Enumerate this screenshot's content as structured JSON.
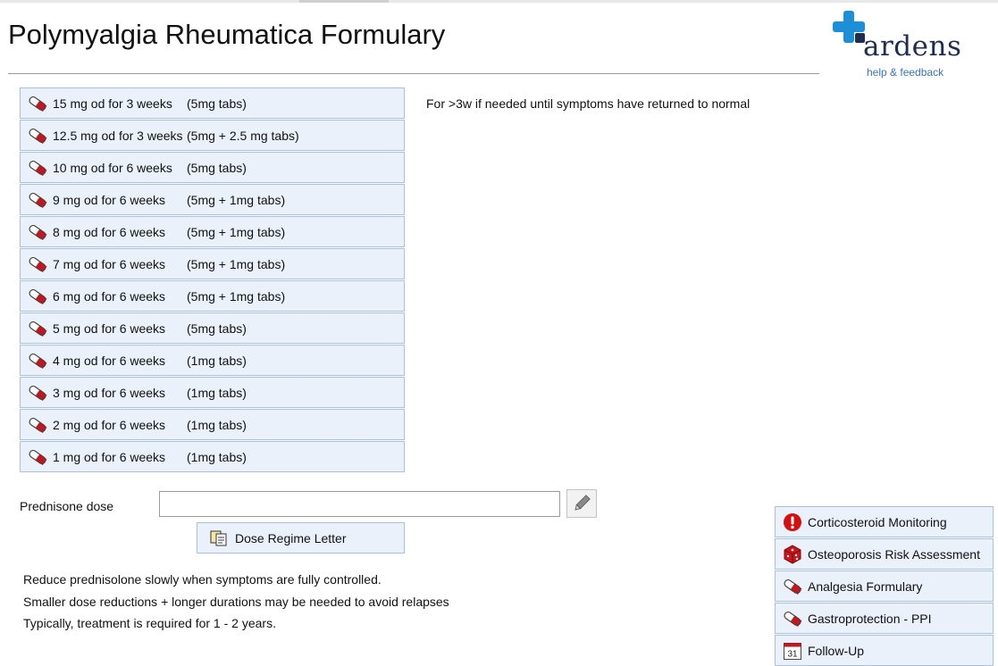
{
  "title": "Polymyalgia Rheumatica Formulary",
  "logo": {
    "name": "ardens",
    "help": "help & feedback"
  },
  "doses": [
    {
      "dose": "15 mg od for 3 weeks",
      "tabs": "(5mg tabs)"
    },
    {
      "dose": "12.5 mg od for 3 weeks",
      "tabs": "(5mg + 2.5 mg tabs)"
    },
    {
      "dose": "10 mg od for 6 weeks",
      "tabs": "(5mg tabs)"
    },
    {
      "dose": "9 mg od for 6 weeks",
      "tabs": "(5mg + 1mg tabs)"
    },
    {
      "dose": "8 mg od for 6 weeks",
      "tabs": "(5mg + 1mg tabs)"
    },
    {
      "dose": "7 mg od for 6 weeks",
      "tabs": "(5mg + 1mg tabs)"
    },
    {
      "dose": "6 mg od for 6 weeks",
      "tabs": "(5mg + 1mg tabs)"
    },
    {
      "dose": "5 mg od for 6 weeks",
      "tabs": "(5mg tabs)"
    },
    {
      "dose": "4 mg od for 6 weeks",
      "tabs": "(1mg tabs)"
    },
    {
      "dose": "3 mg od for 6 weeks",
      "tabs": "(1mg tabs)"
    },
    {
      "dose": "2 mg od for 6 weeks",
      "tabs": "(1mg tabs)"
    },
    {
      "dose": "1 mg od for 6 weeks",
      "tabs": "(1mg tabs)"
    }
  ],
  "first_dose_note": "For >3w if needed until symptoms have returned to normal",
  "prednisone": {
    "label": "Prednisone dose",
    "value": ""
  },
  "letter_button": "Dose Regime Letter",
  "notes": [
    "Reduce prednisolone slowly when symptoms are fully controlled.",
    "Smaller dose reductions + longer durations may be needed to avoid relapses",
    "Typically, treatment is required for 1 - 2 years."
  ],
  "side_links": [
    {
      "label": "Corticosteroid Monitoring",
      "icon": "alert-icon"
    },
    {
      "label": "Osteoporosis Risk Assessment",
      "icon": "dice-icon"
    },
    {
      "label": "Analgesia Formulary",
      "icon": "pill-icon"
    },
    {
      "label": "Gastroprotection - PPI",
      "icon": "pill-icon"
    },
    {
      "label": "Follow-Up",
      "icon": "calendar-icon",
      "calendar_day": "31"
    }
  ],
  "colors": {
    "button_bg": "#eaf1fb",
    "button_border": "#a9c0e2",
    "pill_red": "#c4161c",
    "logo_blue": "#1e8fd6",
    "logo_navy": "#1f2d4f",
    "help_link": "#3a72c4"
  }
}
